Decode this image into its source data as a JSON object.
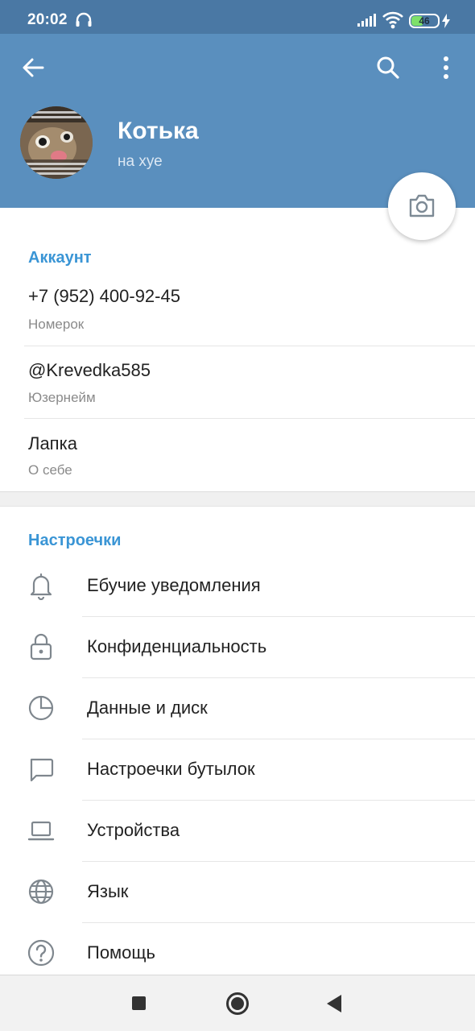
{
  "status_bar": {
    "time": "20:02",
    "battery_level": "46",
    "battery_fraction": 0.46,
    "colors": {
      "background": "#4a78a4",
      "battery_fill": "#7ee06a"
    }
  },
  "header": {
    "name": "Котька",
    "status": "на хуе",
    "colors": {
      "background": "#5a8fbe"
    },
    "icons": [
      "arrow-left-icon",
      "search-icon",
      "more-vertical-icon",
      "camera-icon"
    ]
  },
  "account": {
    "title": "Аккаунт",
    "phone": {
      "value": "+7 (952) 400-92-45",
      "label": "Номерок"
    },
    "username": {
      "value": "@Krevedka585",
      "label": "Юзернейм"
    },
    "bio": {
      "value": "Лапка",
      "label": "О себе"
    }
  },
  "settings": {
    "title": "Настроечки",
    "items": [
      {
        "label": "Ебучие уведомления",
        "icon": "bell-icon"
      },
      {
        "label": "Конфиденциальность",
        "icon": "lock-icon"
      },
      {
        "label": "Данные и диск",
        "icon": "pie-chart-icon"
      },
      {
        "label": "Настроечки бутылок",
        "icon": "chat-bubble-icon"
      },
      {
        "label": "Устройства",
        "icon": "laptop-icon"
      },
      {
        "label": "Язык",
        "icon": "globe-icon"
      },
      {
        "label": "Помощь",
        "icon": "help-icon"
      }
    ]
  },
  "theme": {
    "accent": "#3a95d5"
  }
}
